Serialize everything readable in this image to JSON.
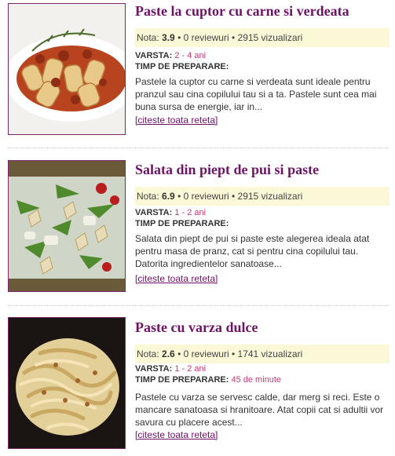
{
  "recipes": [
    {
      "title": "Paste la cuptor cu carne si verdeata",
      "rating_label": "Nota:",
      "rating": "3.9",
      "reviews": "0 reviewuri",
      "views": "2915 vizualizari",
      "age_label": "VARSTA:",
      "age": "2 - 4 ani",
      "prep_label": "TIMP DE PREPARARE:",
      "prep": "",
      "description": "Pastele la cuptor cu carne si verdeata sunt ideale pentru pranzul sau cina copilului tau si a ta. Pastele sunt cea mai buna sursa de energie, iar in...",
      "link": "[citeste toata reteta]",
      "image": "pasta-bake-photo"
    },
    {
      "title": "Salata din piept de pui si paste",
      "rating_label": "Nota:",
      "rating": "6.9",
      "reviews": "0 reviewuri",
      "views": "2915 vizualizari",
      "age_label": "VARSTA:",
      "age": "1 - 2 ani",
      "prep_label": "TIMP DE PREPARARE:",
      "prep": "",
      "description": "Salata din piept de pui si paste este alegerea ideala atat pentru masa de pranz, cat si pentru cina copilului tau. Datorita ingredientelor sanatoase...",
      "link": "[citeste toata reteta]",
      "image": "chicken-pasta-salad-photo"
    },
    {
      "title": "Paste cu varza dulce",
      "rating_label": "Nota:",
      "rating": "2.6",
      "reviews": "0 reviewuri",
      "views": "1741 vizualizari",
      "age_label": "VARSTA:",
      "age": "1 - 2 ani",
      "prep_label": "TIMP DE PREPARARE:",
      "prep": "45 de minute",
      "description": "Pastele cu varza se servesc calde, dar merg si reci. Este o mancare sanatoasa si hranitoare. Atat copii cat si adultii vor savura cu placere acest...",
      "link": "[citeste toata reteta]",
      "image": "cabbage-pasta-photo"
    }
  ],
  "colors": {
    "title": "#6e1466",
    "value_accent": "#c23a78",
    "rating_bg": "#fbf8d8",
    "image_border": "#7a2a6a"
  }
}
